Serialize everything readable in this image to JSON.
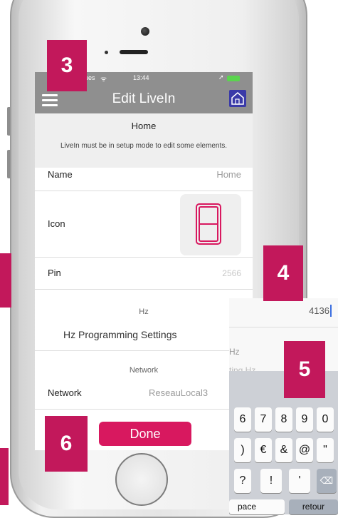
{
  "status": {
    "carrier": "ues",
    "time": "13:44"
  },
  "navbar": {
    "title": "Edit LiveIn"
  },
  "section": {
    "title": "Home",
    "message": "LiveIn must be in setup mode to edit some elements."
  },
  "rows": {
    "name": {
      "label": "Name",
      "value": "Home"
    },
    "icon": {
      "label": "Icon"
    },
    "pin": {
      "label": "Pin",
      "placeholder": "2566"
    },
    "hz_header": "Hz",
    "hz_settings": "Hz Programming Settings",
    "network_header": "Network",
    "network": {
      "label": "Network",
      "value": "ReseauLocal3"
    }
  },
  "overlay": {
    "pin_value": "4136",
    "hz_partial": "Hz",
    "partial_text": "ting Hz"
  },
  "keyboard": {
    "row1": [
      "6",
      "7",
      "8",
      "9",
      "0"
    ],
    "row2": [
      ")",
      "€",
      "&",
      "@",
      "\""
    ],
    "row3": [
      "?",
      "!",
      "'"
    ],
    "space_label": "pace",
    "return_label": "retour"
  },
  "done_label": "Done",
  "badges": [
    "3",
    "4",
    "5",
    "6"
  ],
  "colors": {
    "accent": "#d8185f",
    "badge": "#c2185b",
    "navbar": "#8f8f8f"
  }
}
